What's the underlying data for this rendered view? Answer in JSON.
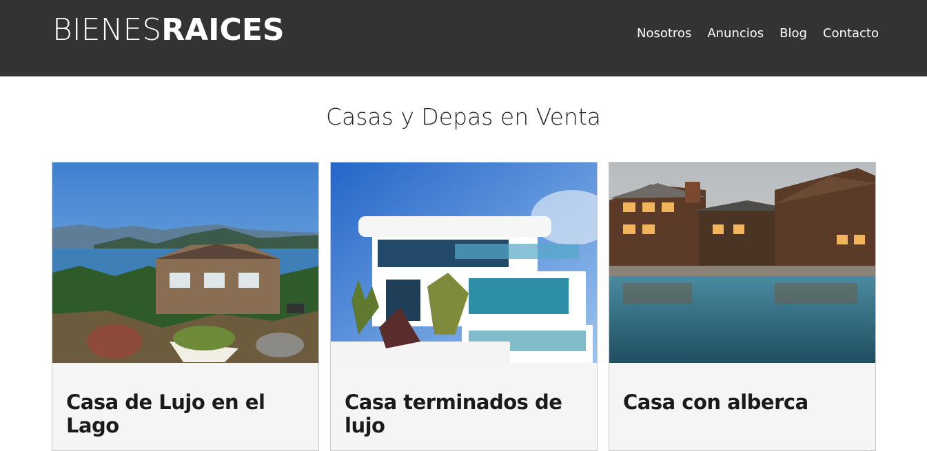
{
  "header": {
    "logo_light": "BIENES",
    "logo_bold": "RAICES",
    "nav": [
      "Nosotros",
      "Anuncios",
      "Blog",
      "Contacto"
    ]
  },
  "main": {
    "title": "Casas y Depas en Venta",
    "cards": [
      {
        "title": "Casa de Lujo en el Lago",
        "image": "lake-house-photo"
      },
      {
        "title": "Casa terminados de lujo",
        "image": "modern-house-photo"
      },
      {
        "title": "Casa con alberca",
        "image": "pool-house-photo"
      }
    ]
  },
  "colors": {
    "header_bg": "#333333",
    "card_bg": "#f5f5f5"
  }
}
